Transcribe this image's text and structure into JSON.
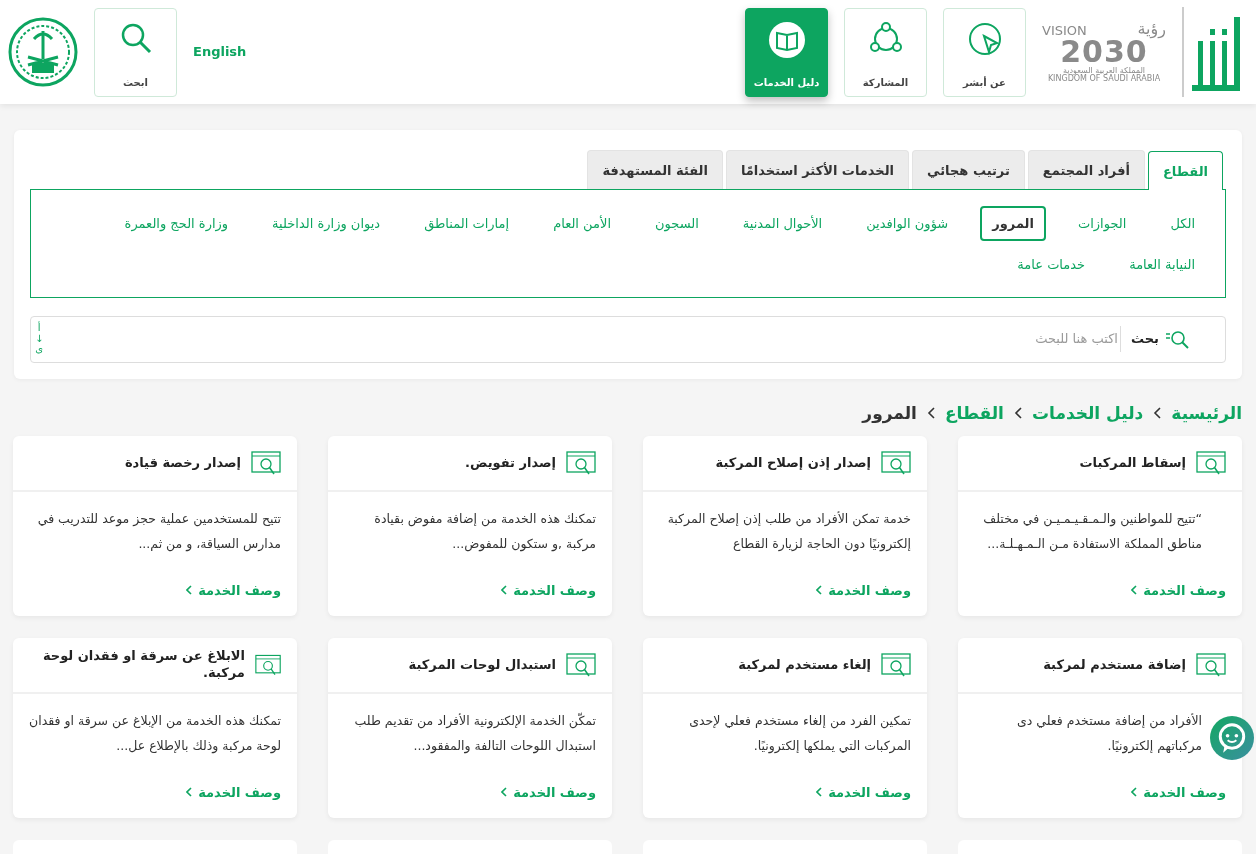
{
  "header": {
    "vision_logo": {
      "vision": "VISION",
      "ruya": "رؤية",
      "year": "2030",
      "country_ar": "المملكة العربية السعودية",
      "country_en": "KINGDOM OF SAUDI ARABIA"
    },
    "nav": [
      {
        "kind": "about",
        "label": "عن أبشر",
        "selected": false
      },
      {
        "kind": "participation",
        "label": "المشاركة",
        "selected": false
      },
      {
        "kind": "guide",
        "label": "دليل الخدمات",
        "selected": true
      }
    ],
    "language": "English",
    "search": {
      "label": "ابحث"
    }
  },
  "tabs": [
    {
      "label": "القطاع",
      "selected": true
    },
    {
      "label": "أفراد المجتمع",
      "selected": false
    },
    {
      "label": "ترتيب هجائي",
      "selected": false
    },
    {
      "label": "الخدمات الأكثر استخدامًا",
      "selected": false
    },
    {
      "label": "الفئة المستهدفة",
      "selected": false
    }
  ],
  "sectors": [
    {
      "label": "الكل",
      "selected": false
    },
    {
      "label": "الجوازات",
      "selected": false
    },
    {
      "label": "المرور",
      "selected": true
    },
    {
      "label": "شؤون الوافدين",
      "selected": false
    },
    {
      "label": "الأحوال المدنية",
      "selected": false
    },
    {
      "label": "السجون",
      "selected": false
    },
    {
      "label": "الأمن العام",
      "selected": false
    },
    {
      "label": "إمارات المناطق",
      "selected": false
    },
    {
      "label": "ديوان وزارة الداخلية",
      "selected": false
    },
    {
      "label": "وزارة الحج والعمرة",
      "selected": false
    },
    {
      "label": "النيابة العامة",
      "selected": false
    },
    {
      "label": "خدمات عامة",
      "selected": false
    }
  ],
  "search": {
    "button": "بحث",
    "placeholder": "اكتب هنا للبحث",
    "sort": [
      "أ",
      "↓",
      "ى"
    ]
  },
  "breadcrumb": [
    "الرئيسية",
    "دليل الخدمات",
    "القطاع",
    "المرور"
  ],
  "cards": [
    {
      "title": "إسقاط المركبات",
      "description": "“تتيح للمواطنين والـمـقـيـمـيـن في مختلف مناطق المملكة الاستفادة مـن الـمـهـلـة...",
      "link": "وصف الخدمة"
    },
    {
      "title": "إصدار إذن إصلاح المركبة",
      "description": "خدمة تمكن الأفراد من طلب إذن إصلاح المركبة إلكترونيًا دون الحاجة لزيارة القطاع",
      "link": "وصف الخدمة"
    },
    {
      "title": "إصدار تفويض.",
      "description": "تمكنك هذه الخدمة من إضافة مفوض بقيادة مركبة ,و ستكون للمفوض...",
      "link": "وصف الخدمة"
    },
    {
      "title": "إصدار رخصة قيادة",
      "description": "تتيح للمستخدمين عملية حجز موعد للتدريب في مدارس السياقة، و من ثم...",
      "link": "وصف الخدمة"
    },
    {
      "title": "إضافة مستخدم لمركبة",
      "description": "الأفراد من إضافة مستخدم فعلي دى مركباتهم إلكترونيًا.",
      "link": "وصف الخدمة"
    },
    {
      "title": "إلغاء مستخدم لمركبة",
      "description": "تمكين الفرد من إلغاء مستخدم فعلي لإحدى المركبات التي يملكها إلكترونيًا.",
      "link": "وصف الخدمة"
    },
    {
      "title": "استبدال لوحات المركبة",
      "description": "تمكّن الخدمة الإلكترونية الأفراد من تقديم طلب استبدال اللوحات التالفة والمفقود...",
      "link": "وصف الخدمة"
    },
    {
      "title": "الابلاغ عن سرقة او فقدان لوحة مركبة.",
      "description": "تمكنك هذه الخدمة من الإبلاغ عن سرقة او فقدان لوحة مركبة وذلك بالإطلاع عل...",
      "link": "وصف الخدمة"
    }
  ]
}
